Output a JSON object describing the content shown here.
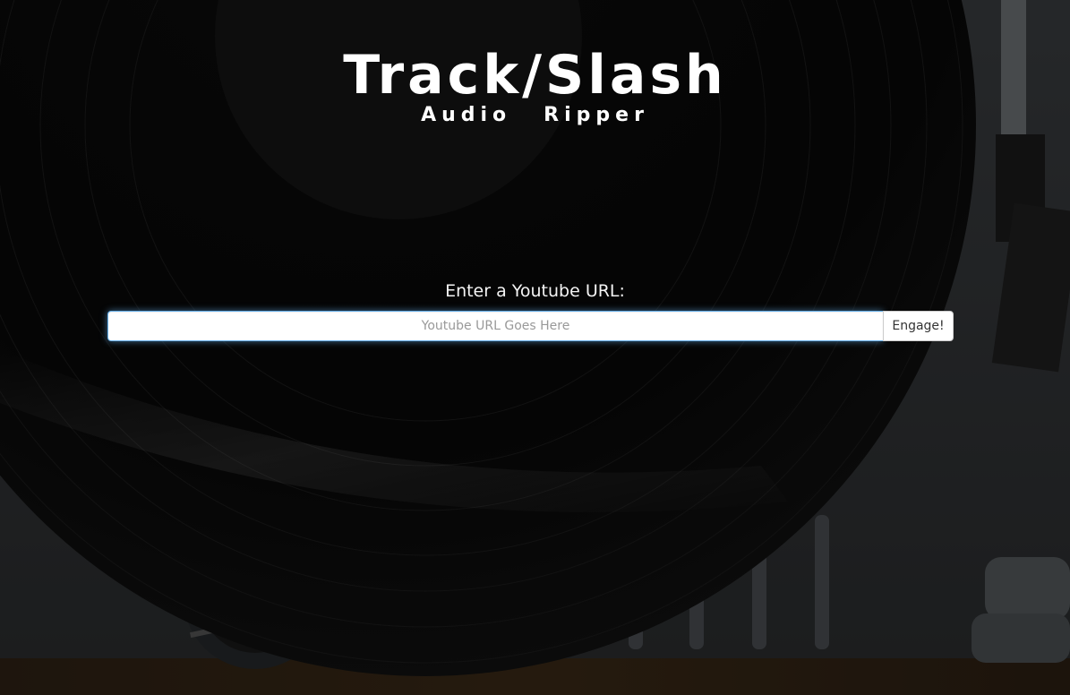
{
  "header": {
    "title": "Track/Slash",
    "subtitle_word1": "Audio",
    "subtitle_word2": "Ripper"
  },
  "form": {
    "label": "Enter a Youtube URL:",
    "input_placeholder": "Youtube URL Goes Here",
    "input_value": "",
    "submit_label": "Engage!"
  },
  "colors": {
    "text": "#ffffff",
    "input_focus_border": "#66afe9",
    "background": "#0b0b0b"
  }
}
